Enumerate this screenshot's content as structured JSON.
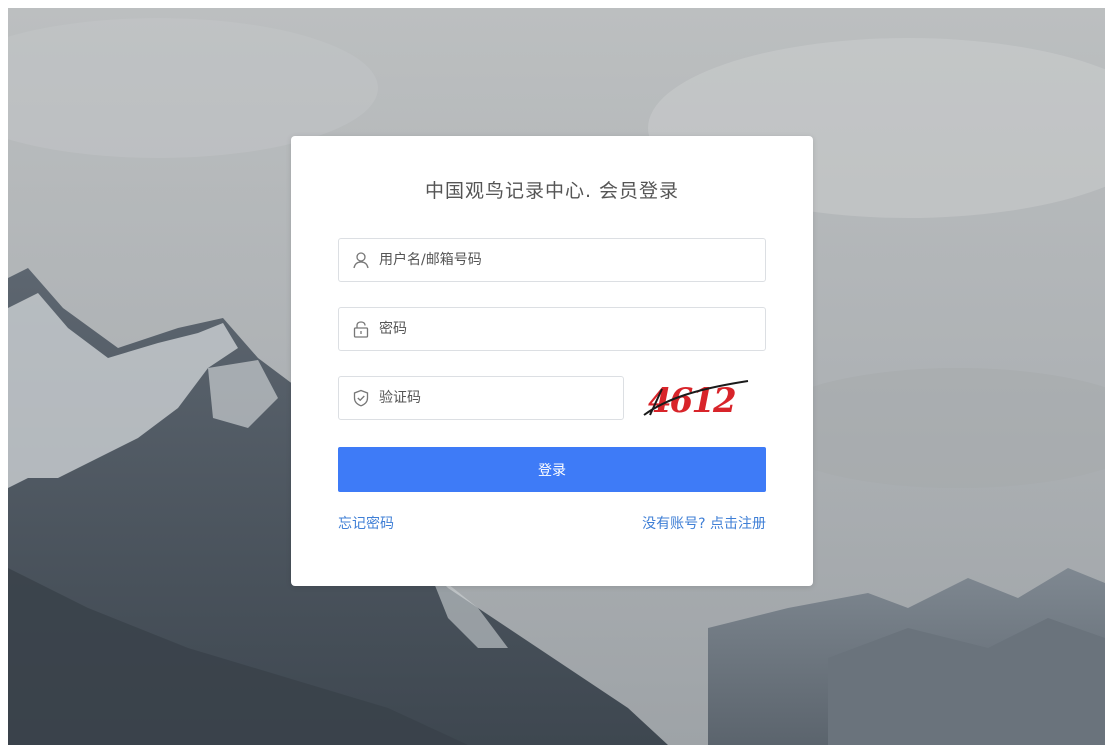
{
  "login": {
    "title": "中国观鸟记录中心. 会员登录",
    "username_placeholder": "用户名/邮箱号码",
    "password_placeholder": "密码",
    "captcha_placeholder": "验证码",
    "captcha_image_text": "4612",
    "submit_label": "登录",
    "forgot_password_label": "忘记密码",
    "register_label": "没有账号? 点击注册"
  },
  "icons": {
    "username": "user-icon",
    "password": "lock-icon",
    "captcha": "shield-check-icon"
  },
  "colors": {
    "primary_button": "#3e7bf7",
    "link": "#3f7fd6",
    "card_background": "#ffffff"
  }
}
